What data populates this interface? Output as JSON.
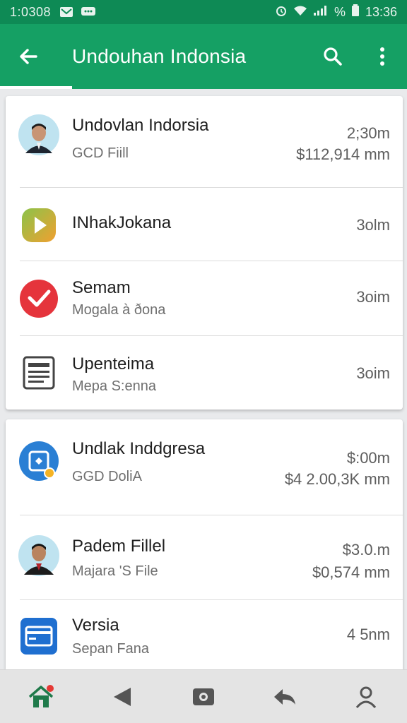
{
  "status_bar": {
    "time_left": "1:0308",
    "time_right": "13:36",
    "battery_text": "%"
  },
  "app_bar": {
    "title": "Undouhan Indonsia"
  },
  "colors": {
    "accent": "#15a064",
    "status_bar": "#0e8a55"
  },
  "cards": [
    {
      "rows": [
        {
          "icon": "person-avatar",
          "title": "Undovlan Indorsia",
          "subtitle": "GCD Fiill",
          "meta1": "2;30m",
          "meta2": "$112,914 mm"
        },
        {
          "icon": "play-app-icon",
          "title": "INhakJokana",
          "subtitle": "",
          "meta1": "3olm",
          "meta2": ""
        },
        {
          "icon": "red-check-icon",
          "title": "Semam",
          "subtitle": "Mogala à ðona",
          "meta1": "3oim",
          "meta2": ""
        },
        {
          "icon": "document-icon",
          "title": "Upenteima",
          "subtitle": "Mepa S:enna",
          "meta1": "3oim",
          "meta2": ""
        }
      ]
    },
    {
      "rows": [
        {
          "icon": "blue-app-icon",
          "title": "Undlak Inddgresa",
          "subtitle": "GGD DoliA",
          "meta1": "$:00m",
          "meta2": "$4 2.00,3K mm"
        },
        {
          "icon": "person-avatar",
          "title": "Padem Fillel",
          "subtitle": "Majara 'S File",
          "meta1": "$3.0.m",
          "meta2": "$0,574 mm"
        },
        {
          "icon": "blue-card-icon",
          "title": "Versia",
          "subtitle": "Sepan Fana",
          "meta1": "4 5nm",
          "meta2": ""
        }
      ]
    }
  ],
  "nav_bar": {
    "items": [
      "home-icon",
      "back-triangle-icon",
      "camera-icon",
      "reply-icon",
      "profile-icon"
    ]
  }
}
